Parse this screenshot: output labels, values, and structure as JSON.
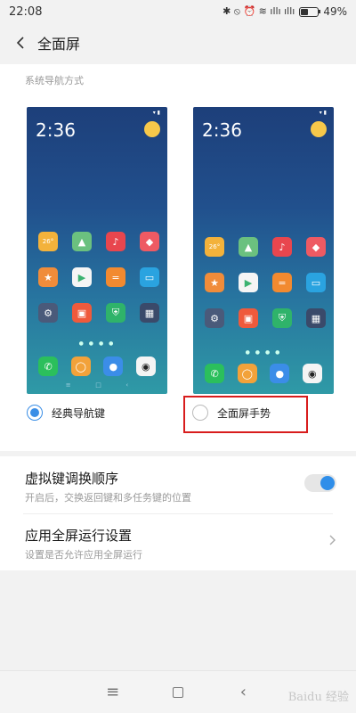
{
  "status_bar": {
    "time": "22:08",
    "icons_text": "✱ ⦸ ⏰ ≋ ıllı ıllı",
    "battery_pct": "49%",
    "battery_level": 0.49
  },
  "header": {
    "title": "全面屏"
  },
  "section": {
    "label": "系统导航方式",
    "preview_time": "2:36",
    "previews": [
      {
        "weather_badge": "26°"
      },
      {
        "weather_badge": "26°"
      }
    ],
    "options": [
      {
        "label": "经典导航键",
        "selected": true
      },
      {
        "label": "全面屏手势",
        "selected": false
      }
    ]
  },
  "settings": [
    {
      "title": "虚拟键调换顺序",
      "subtitle": "开启后，交换返回键和多任务键的位置",
      "control": "toggle",
      "on": true
    },
    {
      "title": "应用全屏运行设置",
      "subtitle": "设置是否允许应用全屏运行",
      "control": "chevron"
    }
  ],
  "bottom_nav": {
    "menu_icon": "≡",
    "back_icon": "‹"
  },
  "watermark": "Baidu 经验",
  "colors": {
    "accent": "#2f8ee9",
    "highlight_box": "#d81d1d"
  }
}
